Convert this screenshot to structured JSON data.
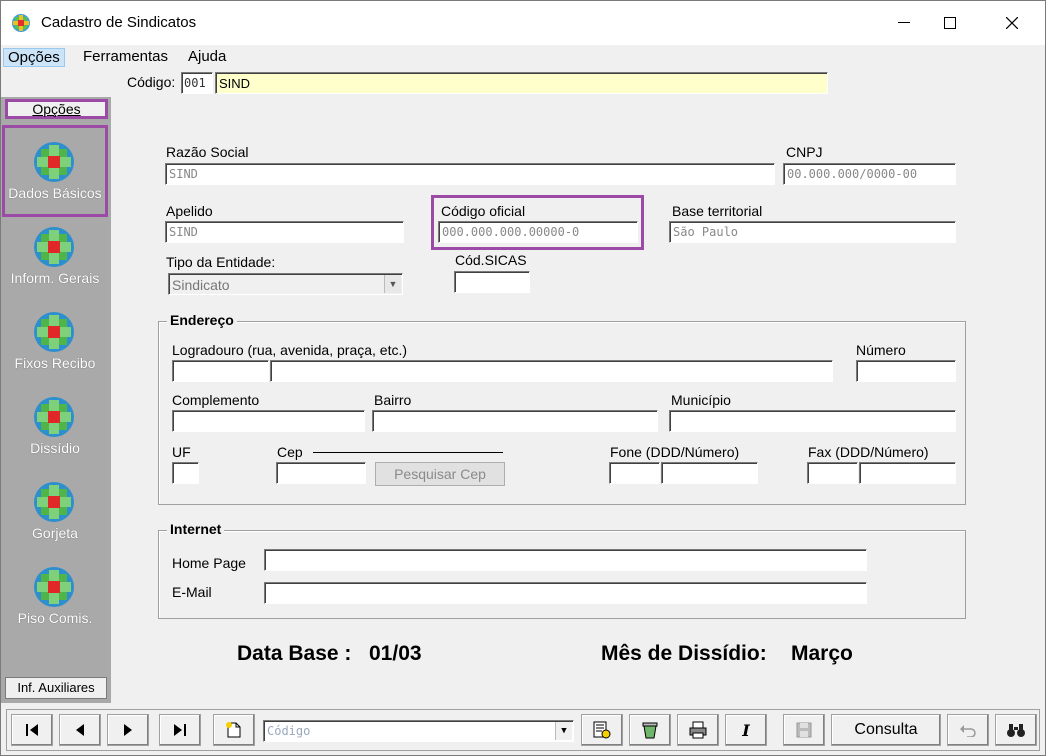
{
  "window": {
    "title": "Cadastro de Sindicatos"
  },
  "menu": {
    "items": [
      "Opções",
      "Ferramentas",
      "Ajuda"
    ]
  },
  "codebar": {
    "label": "Código:",
    "code": "001",
    "name": "SIND"
  },
  "sidebar": {
    "header": "Opções",
    "items": [
      "Dados Básicos",
      "Inform. Gerais",
      "Fixos Recibo",
      "Dissídio",
      "Gorjeta",
      "Piso Comis."
    ],
    "footer": "Inf. Auxiliares"
  },
  "form": {
    "razao_social": {
      "label": "Razão Social",
      "value": "SIND"
    },
    "cnpj": {
      "label": "CNPJ",
      "value": "00.000.000/0000-00"
    },
    "apelido": {
      "label": "Apelido",
      "value": "SIND"
    },
    "codigo_oficial": {
      "label": "Código oficial",
      "value": "000.000.000.00000-0"
    },
    "base_territorial": {
      "label": "Base territorial",
      "value": "São Paulo"
    },
    "tipo_entidade": {
      "label": "Tipo da Entidade:",
      "value": "Sindicato"
    },
    "cod_sicas": {
      "label": "Cód.SICAS",
      "value": ""
    }
  },
  "endereco": {
    "title": "Endereço",
    "logradouro": "Logradouro (rua, avenida, praça, etc.)",
    "numero": "Número",
    "complemento": "Complemento",
    "bairro": "Bairro",
    "municipio": "Município",
    "uf": "UF",
    "cep": "Cep",
    "pesquisar_cep": "Pesquisar Cep",
    "fone": "Fone (DDD/Número)",
    "fax": "Fax (DDD/Número)"
  },
  "internet": {
    "title": "Internet",
    "home_page": "Home Page",
    "email": "E-Mail"
  },
  "footer_info": {
    "data_base_label": "Data Base :",
    "data_base": "01/03",
    "mes_label": "Mês de Dissídio:",
    "mes": "Março"
  },
  "toolbar": {
    "combo_placeholder": "Código",
    "consulta": "Consulta"
  }
}
